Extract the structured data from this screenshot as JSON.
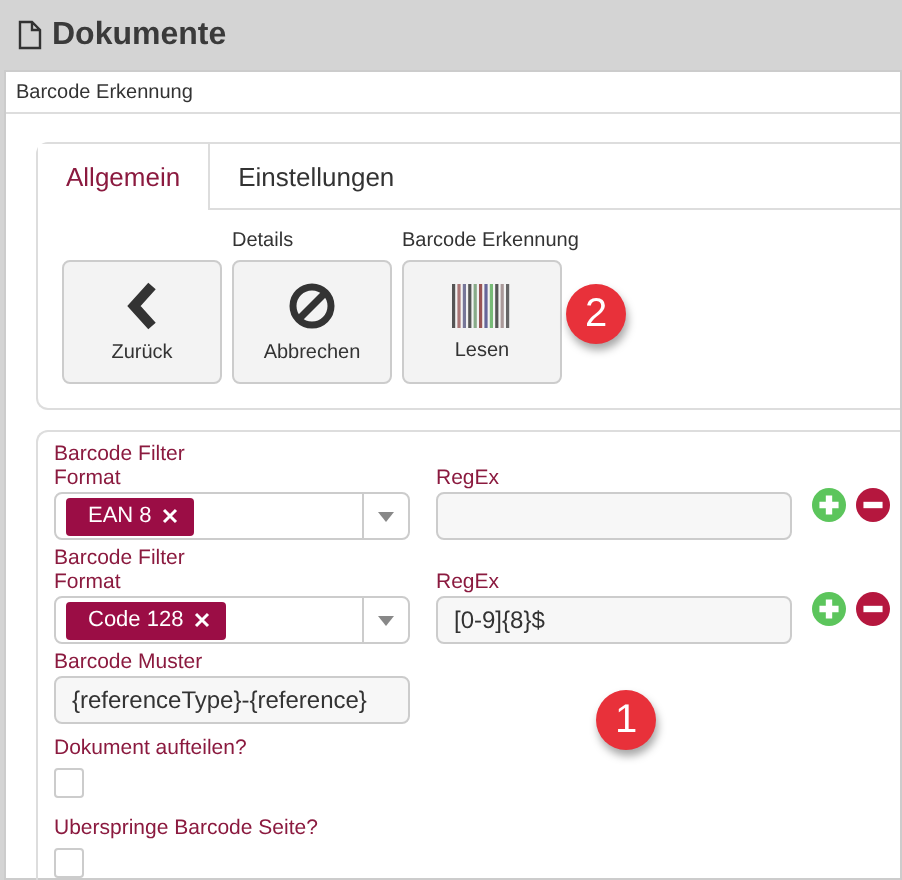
{
  "header": {
    "title": "Dokumente"
  },
  "panel": {
    "title": "Barcode Erkennung"
  },
  "tabs": [
    {
      "label": "Allgemein",
      "selected": true
    },
    {
      "label": "Einstellungen",
      "selected": false
    }
  ],
  "action_groups": [
    {
      "buttons": [
        {
          "kind": "back",
          "label": "Zurück"
        }
      ]
    },
    {
      "label": "Details",
      "buttons": [
        {
          "kind": "cancel",
          "label": "Abbrechen"
        }
      ]
    },
    {
      "label": "Barcode Erkennung",
      "buttons": [
        {
          "kind": "barcode",
          "label": "Lesen"
        }
      ]
    }
  ],
  "filters": [
    {
      "title": "Barcode Filter",
      "format_label": "Format",
      "tags": [
        "EAN 8"
      ],
      "regex_label": "RegEx"
    },
    {
      "title": "Barcode Filter",
      "format_label": "Format",
      "tags": [
        "Code 128"
      ],
      "regex_label": "RegEx",
      "regex_value": "[0-9]{8}$"
    }
  ],
  "pattern": {
    "label": "Barcode Muster",
    "value": "{referenceType}-{reference}"
  },
  "checkboxes": [
    {
      "label": "Dokument aufteilen?",
      "checked": false
    },
    {
      "label": "Uberspringe Barcode Seite?",
      "checked": false
    }
  ],
  "markers": [
    {
      "number": "2"
    },
    {
      "number": "1"
    }
  ]
}
